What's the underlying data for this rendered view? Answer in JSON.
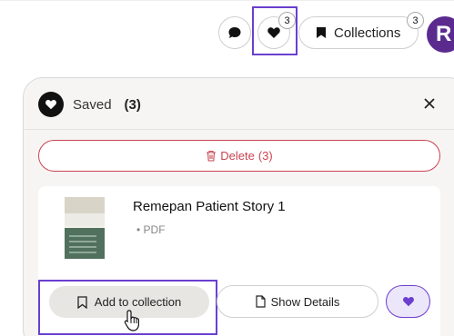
{
  "toolbar": {
    "chat_icon": "chat-bubble-icon",
    "heart_icon": "heart-icon",
    "heart_count": "3",
    "collections_label": "Collections",
    "collections_count": "3",
    "avatar_initial": "R"
  },
  "panel": {
    "title": "Saved",
    "count": "(3)",
    "delete_label": "Delete",
    "delete_count": "(3)"
  },
  "item": {
    "title": "Remepan Patient Story 1",
    "type": "• PDF",
    "add_label": "Add to collection",
    "details_label": "Show Details"
  },
  "colors": {
    "accent": "#6b3fd0",
    "danger": "#c94452",
    "avatar_bg": "#5b2a8f"
  }
}
